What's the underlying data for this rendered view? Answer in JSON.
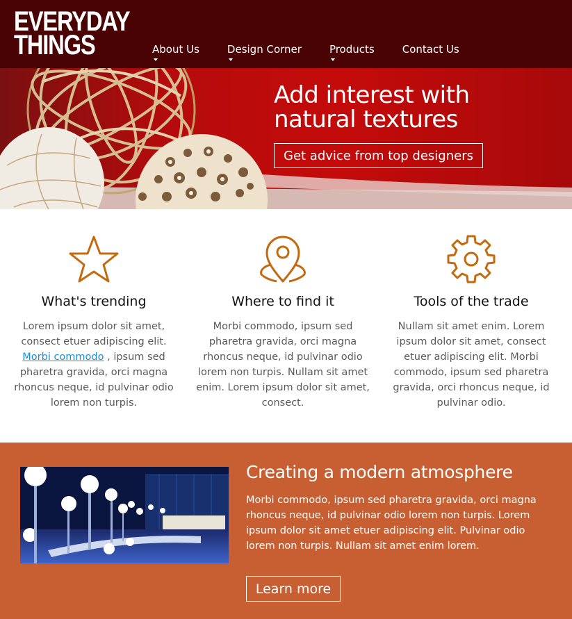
{
  "header": {
    "logo_line1": "EVERYDAY",
    "logo_line2": "THINGS",
    "nav": [
      {
        "label": "About Us",
        "has_dropdown": true
      },
      {
        "label": "Design Corner",
        "has_dropdown": true
      },
      {
        "label": "Products",
        "has_dropdown": true
      },
      {
        "label": "Contact Us",
        "has_dropdown": false
      }
    ]
  },
  "hero": {
    "title_line1": "Add interest with",
    "title_line2": "natural textures",
    "cta": "Get advice from top designers"
  },
  "features": [
    {
      "icon": "star-icon",
      "title": "What's trending",
      "text_before": "Lorem ipsum dolor sit amet, consect etuer adipiscing elit.",
      "link": "Morbi commodo",
      "text_after": ", ipsum sed pharetra gravida, orci magna rhoncus neque, id pulvinar odio lorem non turpis."
    },
    {
      "icon": "map-pin-icon",
      "title": "Where to find it",
      "text": "Morbi commodo, ipsum sed pharetra gravida, orci magna rhoncus neque, id pulvinar odio lorem non turpis. Nullam sit amet enim. Lorem ipsum dolor sit amet, consect."
    },
    {
      "icon": "gear-icon",
      "title": "Tools of the trade",
      "text": "Nullam sit amet enim. Lorem ipsum dolor sit amet, consect etuer adipiscing elit. Morbi commodo, ipsum sed pharetra gravida, orci rhoncus neque, id pulvinar odio."
    }
  ],
  "promo": {
    "title": "Creating a modern atmosphere",
    "body": "Morbi commodo, ipsum sed pharetra gravida, orci magna rhoncus neque, id pulvinar odio lorem non turpis. Lorem ipsum dolor sit amet etuer adipiscing elit. Pulvinar odio lorem non turpis. Nullam sit amet enim lorem.",
    "button": "Learn more"
  },
  "colors": {
    "header_bg": "#4a0304",
    "hero_bg": "#c30b0a",
    "icon_accent": "#c46a0e",
    "promo_bg": "#c75f32",
    "link": "#1a8ed6"
  }
}
